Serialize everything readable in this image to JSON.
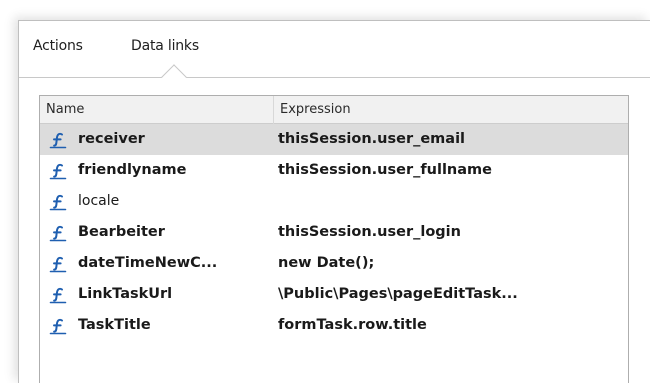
{
  "tabs": [
    {
      "label": "Actions"
    },
    {
      "label": "Data links"
    }
  ],
  "grid": {
    "columns": [
      "Name",
      "Expression"
    ],
    "rows": [
      {
        "name": "receiver",
        "expression": "thisSession.user_email",
        "bold": true,
        "selected": true,
        "icon": "variable-link-icon"
      },
      {
        "name": "friendlyname",
        "expression": "thisSession.user_fullname",
        "bold": true,
        "selected": false,
        "icon": "variable-link-icon"
      },
      {
        "name": "locale",
        "expression": "",
        "bold": false,
        "selected": false,
        "icon": "variable-link-icon"
      },
      {
        "name": "Bearbeiter",
        "expression": "thisSession.user_login",
        "bold": true,
        "selected": false,
        "icon": "variable-link-icon"
      },
      {
        "name": "dateTimeNewC...",
        "expression": "new Date();",
        "bold": true,
        "selected": false,
        "icon": "variable-link-icon"
      },
      {
        "name": "LinkTaskUrl",
        "expression": "\\Public\\Pages\\pageEditTask...",
        "bold": true,
        "selected": false,
        "icon": "variable-link-icon"
      },
      {
        "name": "TaskTitle",
        "expression": "formTask.row.title",
        "bold": true,
        "selected": false,
        "icon": "variable-link-icon"
      }
    ]
  },
  "colors": {
    "icon": "#1f5fb0",
    "selected_row": "#dcdcdc",
    "header_bg": "#f1f1f1"
  }
}
